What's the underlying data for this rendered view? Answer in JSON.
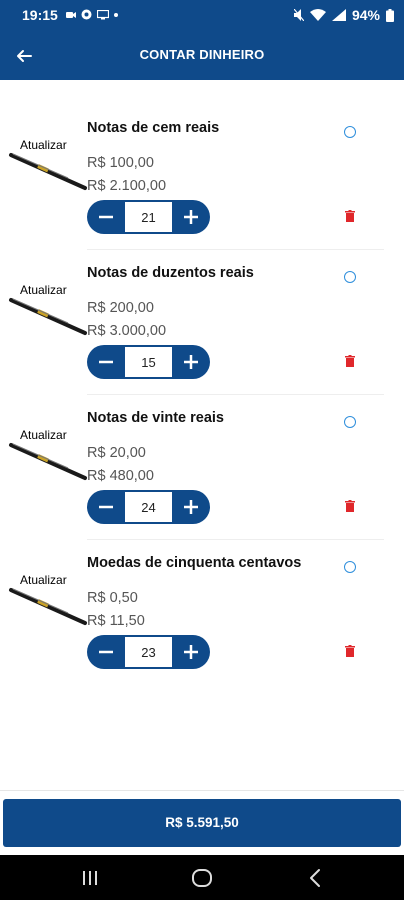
{
  "status_bar": {
    "time": "19:15",
    "battery": "94%"
  },
  "header": {
    "title": "CONTAR DINHEIRO"
  },
  "items": [
    {
      "update_label": "Atualizar",
      "name": "Notas de cem reais",
      "unit_value": "R$ 100,00",
      "total_value": "R$ 2.100,00",
      "quantity": "21"
    },
    {
      "update_label": "Atualizar",
      "name": "Notas de duzentos reais",
      "unit_value": "R$ 200,00",
      "total_value": "R$ 3.000,00",
      "quantity": "15"
    },
    {
      "update_label": "Atualizar",
      "name": "Notas de vinte reais",
      "unit_value": "R$ 20,00",
      "total_value": "R$ 480,00",
      "quantity": "24"
    },
    {
      "update_label": "Atualizar",
      "name": "Moedas de cinquenta centavos",
      "unit_value": "R$ 0,50",
      "total_value": "R$ 11,50",
      "quantity": "23"
    }
  ],
  "footer": {
    "total_button": "R$ 5.591,50"
  },
  "colors": {
    "primary": "#0f4a8a",
    "delete": "#e0272b",
    "radio": "#2f8fdc"
  },
  "icons": {
    "back": "arrow-left-icon",
    "edit": "pen-icon",
    "delete": "trash-icon",
    "select": "radio-icon",
    "minus": "minus-icon",
    "plus": "plus-icon"
  }
}
